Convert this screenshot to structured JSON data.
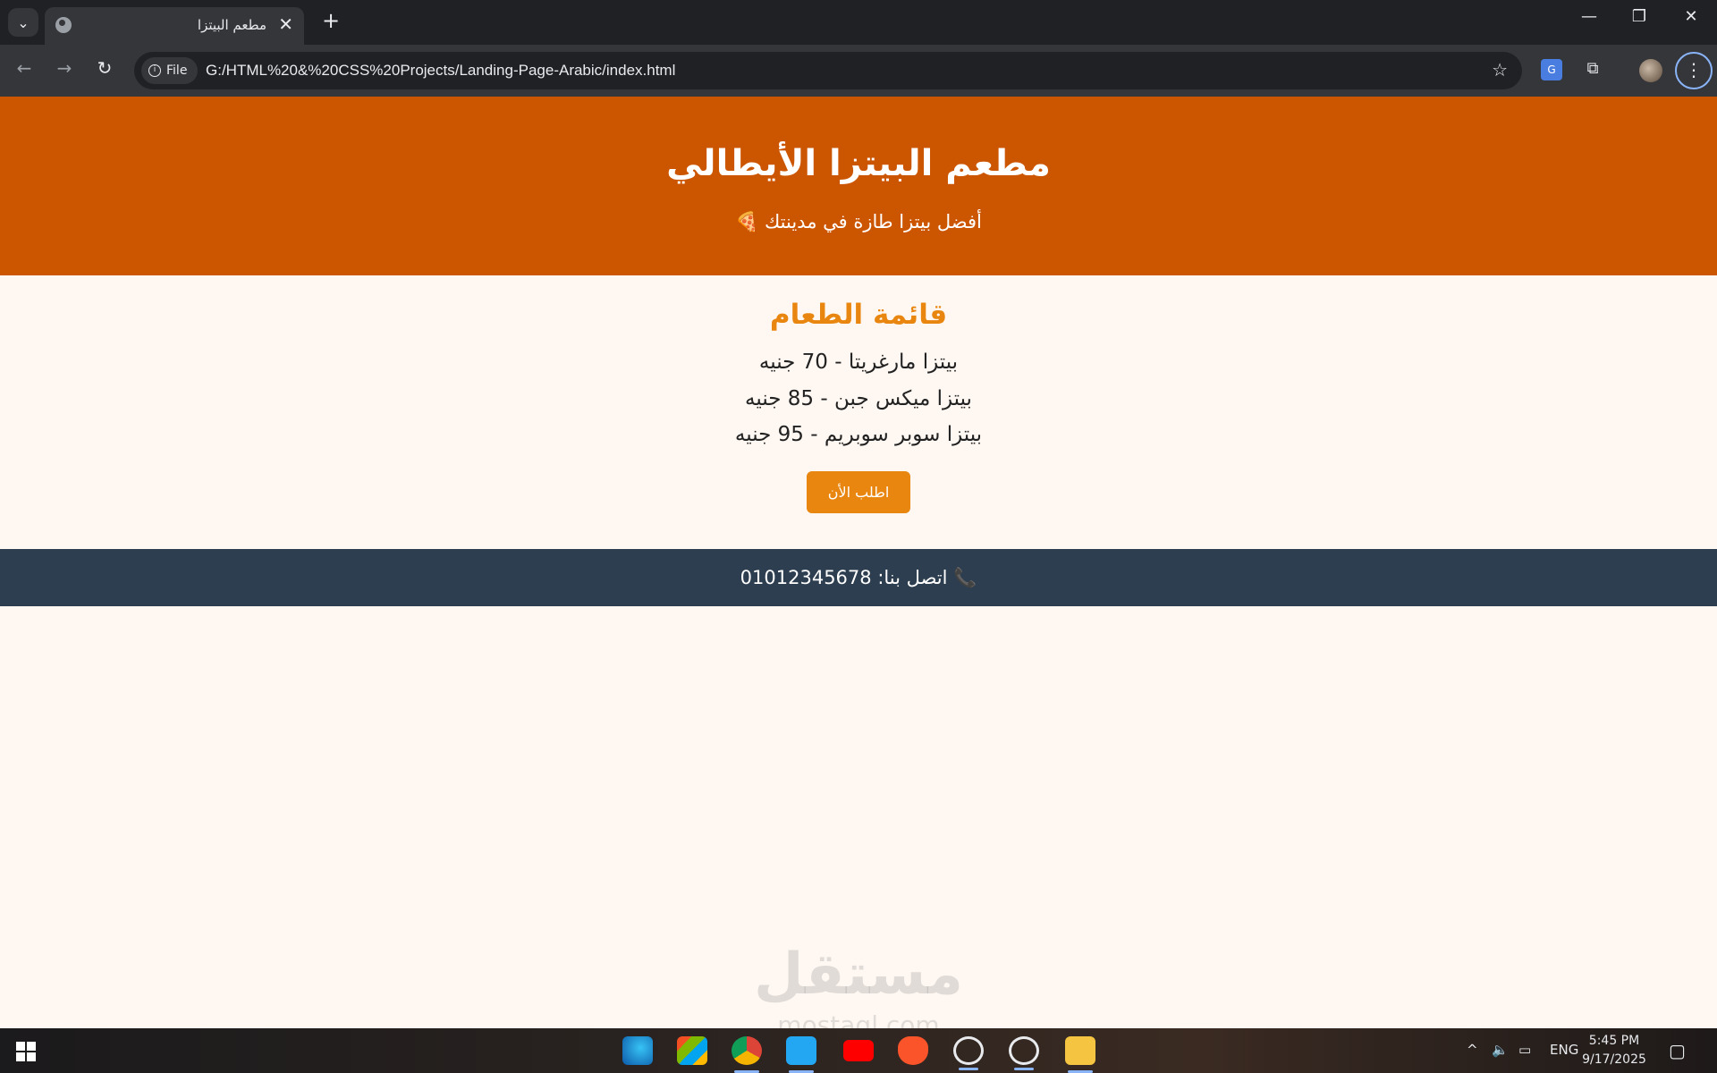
{
  "browser": {
    "tab_title": "مطعم البيتزا",
    "tab_close": "✕",
    "new_tab": "+",
    "address_chip": "File",
    "url": "G:/HTML%20&%20CSS%20Projects/Landing-Page-Arabic/index.html"
  },
  "hero": {
    "title": "مطعم البيتزا الأيطالي",
    "tagline": "أفضل بيتزا طازة في مدينتك 🍕"
  },
  "menu": {
    "heading": "قائمة الطعام",
    "items": [
      "بيتزا مارغريتا - 70 جنيه",
      "بيتزا ميكس جبن - 85 جنيه",
      "بيتزا سوبر سوبريم - 95 جنيه"
    ],
    "order_button": "اطلب الأن"
  },
  "footer": {
    "phone_icon": "📞",
    "contact": "اتصل بنا: 01012345678"
  },
  "watermark": {
    "text": "مستقل",
    "sub": "mostaql.com"
  },
  "taskbar": {
    "language": "ENG",
    "time": "5:45 PM",
    "date": "9/17/2025"
  },
  "colors": {
    "hero_bg": "#cc5500",
    "accent": "#e8860f",
    "footer_bg": "#2c3e50",
    "page_bg": "#fff8f2"
  },
  "icons": {
    "tab_search": "chevron-down-icon",
    "back": "arrow-left-icon",
    "forward": "arrow-right-icon",
    "reload": "reload-icon",
    "bookmark": "star-icon",
    "extensions": "puzzle-icon",
    "menu": "kebab-menu-icon",
    "start": "windows-logo-icon"
  }
}
